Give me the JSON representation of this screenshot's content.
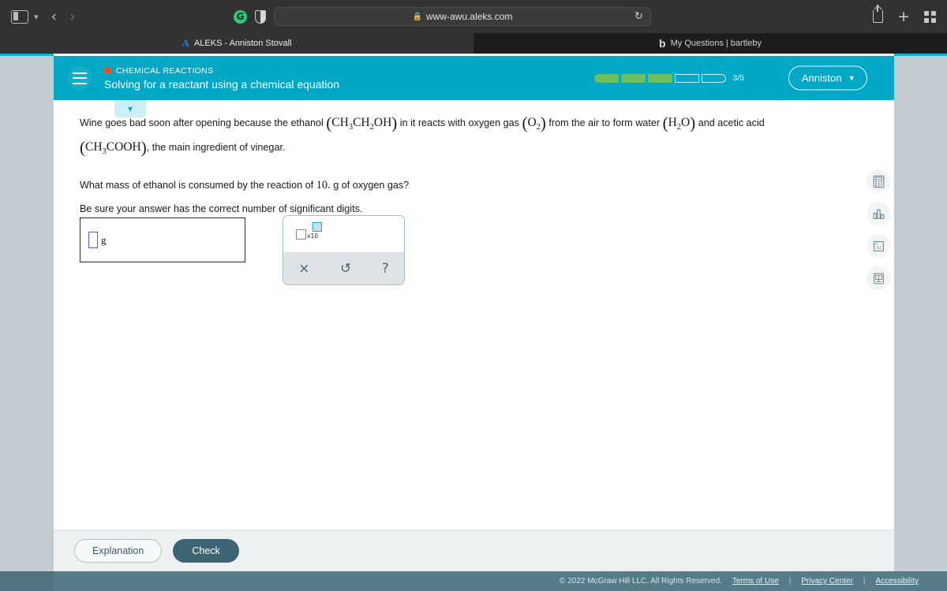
{
  "browser": {
    "url": "www-awu.aleks.com",
    "lock_icon": "lock-icon",
    "reload_icon": "reload-icon",
    "back_icon": "back-arrow-icon",
    "forward_icon": "forward-arrow-icon",
    "sidebar_icon": "sidebar-toggle-icon",
    "extension_g": "G",
    "share_icon": "share-icon",
    "newtab_icon": "plus-icon",
    "tabgrid_icon": "tab-overview-icon",
    "tabs": [
      {
        "title": "ALEKS - Anniston Stovall",
        "favicon": "A",
        "active": true
      },
      {
        "title": "My Questions | bartleby",
        "favicon": "b",
        "active": false
      }
    ]
  },
  "app_header": {
    "menu_icon": "hamburger-menu-icon",
    "topic": "CHEMICAL REACTIONS",
    "lesson_title": "Solving for a reactant using a chemical equation",
    "progress": {
      "total": 5,
      "filled": 3,
      "label": "3/5"
    },
    "user": {
      "name": "Anniston",
      "chevron": "∨"
    },
    "accent_color": "#00a8c6",
    "topic_dot_color": "#ff4500",
    "progress_fill_color": "#6cbf5a"
  },
  "collapse_tab": {
    "icon": "chevron-down-icon",
    "glyph": "⌄"
  },
  "question": {
    "line1_a": "Wine goes bad soon after opening because the ethanol",
    "formula_ethanol": "CH3CH2OH",
    "line1_b": "in it reacts with oxygen gas",
    "formula_oxygen": "O2",
    "line1_c": "from the air to form water",
    "formula_water": "H2O",
    "line1_d": "and acetic acid",
    "formula_acetic": "CH3COOH",
    "line2_tail": ", the main ingredient of vinegar.",
    "prompt_a": "What mass of ethanol is consumed by the reaction of",
    "prompt_value": "10.",
    "prompt_b": "g of oxygen gas?",
    "sigfig_note": "Be sure your answer has the correct number of significant digits."
  },
  "answer": {
    "value": "",
    "placeholder": "",
    "unit": "g"
  },
  "palette": {
    "sci_notation": {
      "name": "scientific-notation-button",
      "mantissa": "□",
      "times_ten": "x10",
      "exponent": "□"
    },
    "clear": {
      "name": "clear-button",
      "glyph": "×"
    },
    "undo": {
      "name": "undo-button",
      "glyph": "↺"
    },
    "help": {
      "name": "help-button",
      "glyph": "?"
    }
  },
  "tools": [
    {
      "name": "calculator-tool",
      "label": "Calculator"
    },
    {
      "name": "data-chart-tool",
      "label": "Data"
    },
    {
      "name": "periodic-table-tool",
      "label": "Ar"
    },
    {
      "name": "reference-tool",
      "label": "Reference"
    }
  ],
  "actions": {
    "explanation": "Explanation",
    "check": "Check"
  },
  "legal": {
    "copyright": "© 2022 McGraw Hill LLC. All Rights Reserved.",
    "links": [
      "Terms of Use",
      "Privacy Center",
      "Accessibility"
    ],
    "separator": "|"
  }
}
